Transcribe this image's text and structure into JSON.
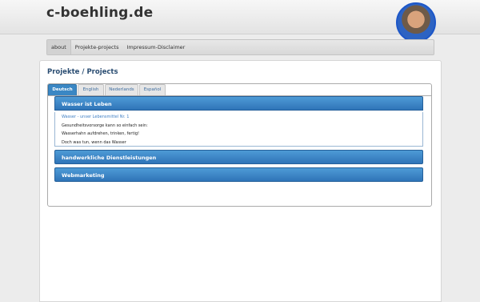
{
  "header": {
    "site_title": "c-boehling.de"
  },
  "nav": {
    "items": [
      "about",
      "Projekte-projects",
      "Impressum-Disclaimer"
    ],
    "active": "about"
  },
  "page": {
    "title": "Projekte / Projects"
  },
  "tabs": {
    "items": [
      "Deutsch",
      "English",
      "Nederlands",
      "Español"
    ],
    "active": "Deutsch"
  },
  "accordion": {
    "sections": [
      {
        "title": "Wasser ist Leben",
        "open": true,
        "link": "Wasser - unser Lebensmittel Nr. 1",
        "lines": [
          "Gesundheitsvorsorge kann so einfach sein:",
          "Wasserhahn aufdrehen, trinken, fertig!",
          "Doch was tun, wenn das Wasser"
        ]
      },
      {
        "title": "handwerkliche Dienstleistungen",
        "open": false
      },
      {
        "title": "Webmarketing",
        "open": false
      }
    ]
  },
  "colors": {
    "accent": "#3a87c4",
    "title_blue": "#2a4d72",
    "link": "#3f7fc4"
  }
}
